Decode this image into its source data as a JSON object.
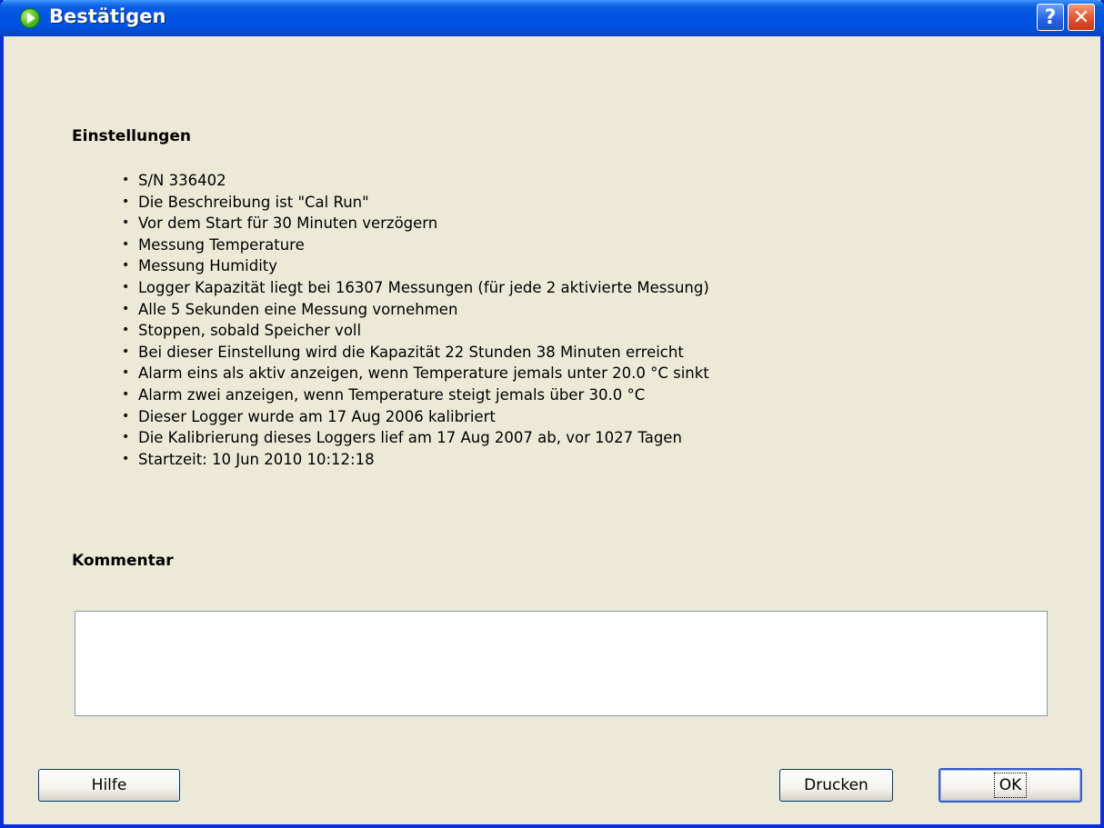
{
  "window": {
    "title": "Bestätigen",
    "help_button": "?",
    "close_button": "✕"
  },
  "settings": {
    "heading": "Einstellungen",
    "items": [
      "S/N 336402",
      "Die Beschreibung ist \"Cal Run\"",
      "Vor dem Start für 30 Minuten verzögern",
      "Messung Temperature",
      "Messung Humidity",
      "Logger Kapazität liegt bei 16307 Messungen (für jede 2 aktivierte Messung)",
      "Alle 5 Sekunden eine Messung vornehmen",
      "Stoppen, sobald Speicher voll",
      "Bei dieser Einstellung wird die Kapazität 22 Stunden 38 Minuten erreicht",
      "Alarm eins als aktiv anzeigen, wenn Temperature jemals unter 20.0 °C sinkt",
      "Alarm zwei anzeigen, wenn Temperature steigt jemals über 30.0 °C",
      "Dieser Logger wurde am 17 Aug 2006 kalibriert",
      "Die Kalibrierung dieses Loggers lief am 17 Aug 2007 ab, vor 1027 Tagen",
      "Startzeit: 10 Jun 2010 10:12:18"
    ]
  },
  "comment": {
    "heading": "Kommentar",
    "value": ""
  },
  "buttons": {
    "help": "Hilfe",
    "print": "Drucken",
    "ok": "OK"
  },
  "colors": {
    "titlebar": "#0054e3",
    "window_bg": "#ece9d8",
    "close_button": "#e2532b"
  }
}
